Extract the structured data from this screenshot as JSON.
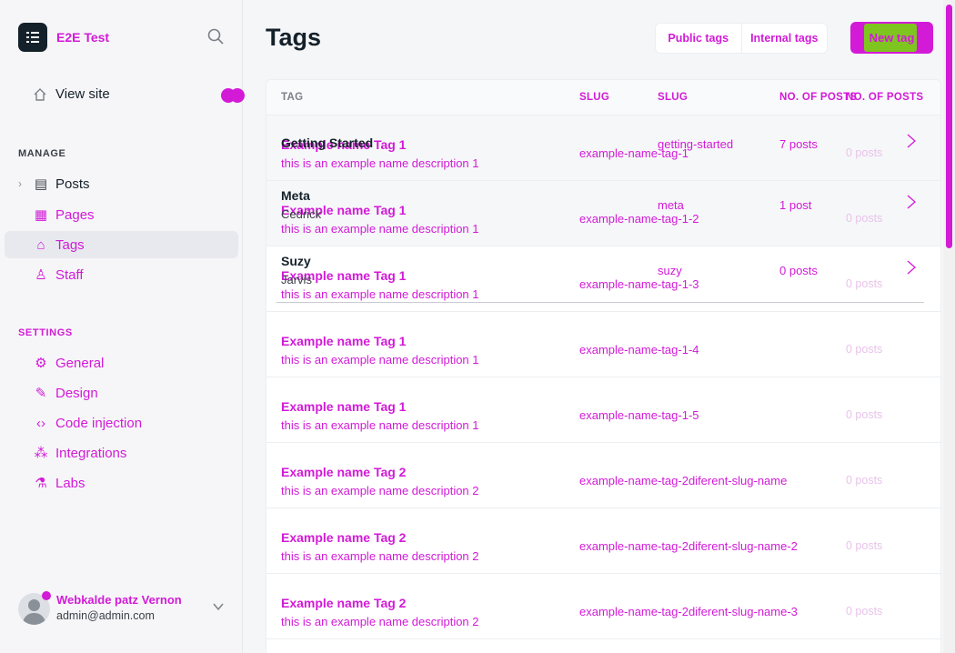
{
  "sidebar": {
    "brand": "E2E Test",
    "view_site": "View site",
    "manage_title": "MANAGE",
    "settings_title": "SETTINGS",
    "manage_items": [
      {
        "label": "Posts",
        "icon": "posts-icon"
      },
      {
        "label": "Pages",
        "icon": "pages-icon"
      },
      {
        "label": "Tags",
        "icon": "tag-icon"
      },
      {
        "label": "Staff",
        "icon": "staff-icon"
      }
    ],
    "settings_items": [
      {
        "label": "General",
        "icon": "gear-icon"
      },
      {
        "label": "Design",
        "icon": "brush-icon"
      },
      {
        "label": "Code injection",
        "icon": "code-icon"
      },
      {
        "label": "Integrations",
        "icon": "integrations-icon"
      },
      {
        "label": "Labs",
        "icon": "flask-icon"
      }
    ],
    "user": {
      "name": "Webkalde patz Vernon",
      "email": "admin@admin.com"
    }
  },
  "header": {
    "title": "Tags",
    "filters": [
      "Public tags",
      "Internal tags"
    ],
    "new_tag": "New tag"
  },
  "table": {
    "columns": [
      "TAG",
      "SLUG",
      "SLUG",
      "NO. OF POSTS",
      "NO. OF POSTS"
    ],
    "rows": [
      {
        "name": "Example name Tag 1",
        "desc": "this is an example name description 1",
        "slug": "example-name-tag-1",
        "count": "0 posts"
      },
      {
        "name": "Example name Tag 1",
        "desc": "this is an example name description 1",
        "slug": "example-name-tag-1-2",
        "count": "0 posts"
      },
      {
        "name": "Example name Tag 1",
        "desc": "this is an example name description 1",
        "slug": "example-name-tag-1-3",
        "count": "0 posts"
      },
      {
        "name": "Example name Tag 1",
        "desc": "this is an example name description 1",
        "slug": "example-name-tag-1-4",
        "count": "0 posts"
      },
      {
        "name": "Example name Tag 1",
        "desc": "this is an example name description 1",
        "slug": "example-name-tag-1-5",
        "count": "0 posts"
      },
      {
        "name": "Example name Tag 2",
        "desc": "this is an example name description 2",
        "slug": "example-name-tag-2diferent-slug-name",
        "count": "0 posts"
      },
      {
        "name": "Example name Tag 2",
        "desc": "this is an example name description 2",
        "slug": "example-name-tag-2diferent-slug-name-2",
        "count": "0 posts"
      },
      {
        "name": "Example name Tag 2",
        "desc": "this is an example name description 2",
        "slug": "example-name-tag-2diferent-slug-name-3",
        "count": "0 posts"
      }
    ],
    "overlay_rows": [
      {
        "name": "Getting Started",
        "sub": "",
        "slug": "getting-started",
        "count": "7 posts"
      },
      {
        "name": "Meta",
        "sub": "Cedrick",
        "slug": "meta",
        "count": "1 post"
      },
      {
        "name": "Suzy",
        "sub": "Jarvis",
        "slug": "suzy",
        "count": "0 posts"
      }
    ]
  },
  "colors": {
    "accent": "#d21ad7",
    "dark": "#15212a",
    "green": "#7fc51f"
  }
}
